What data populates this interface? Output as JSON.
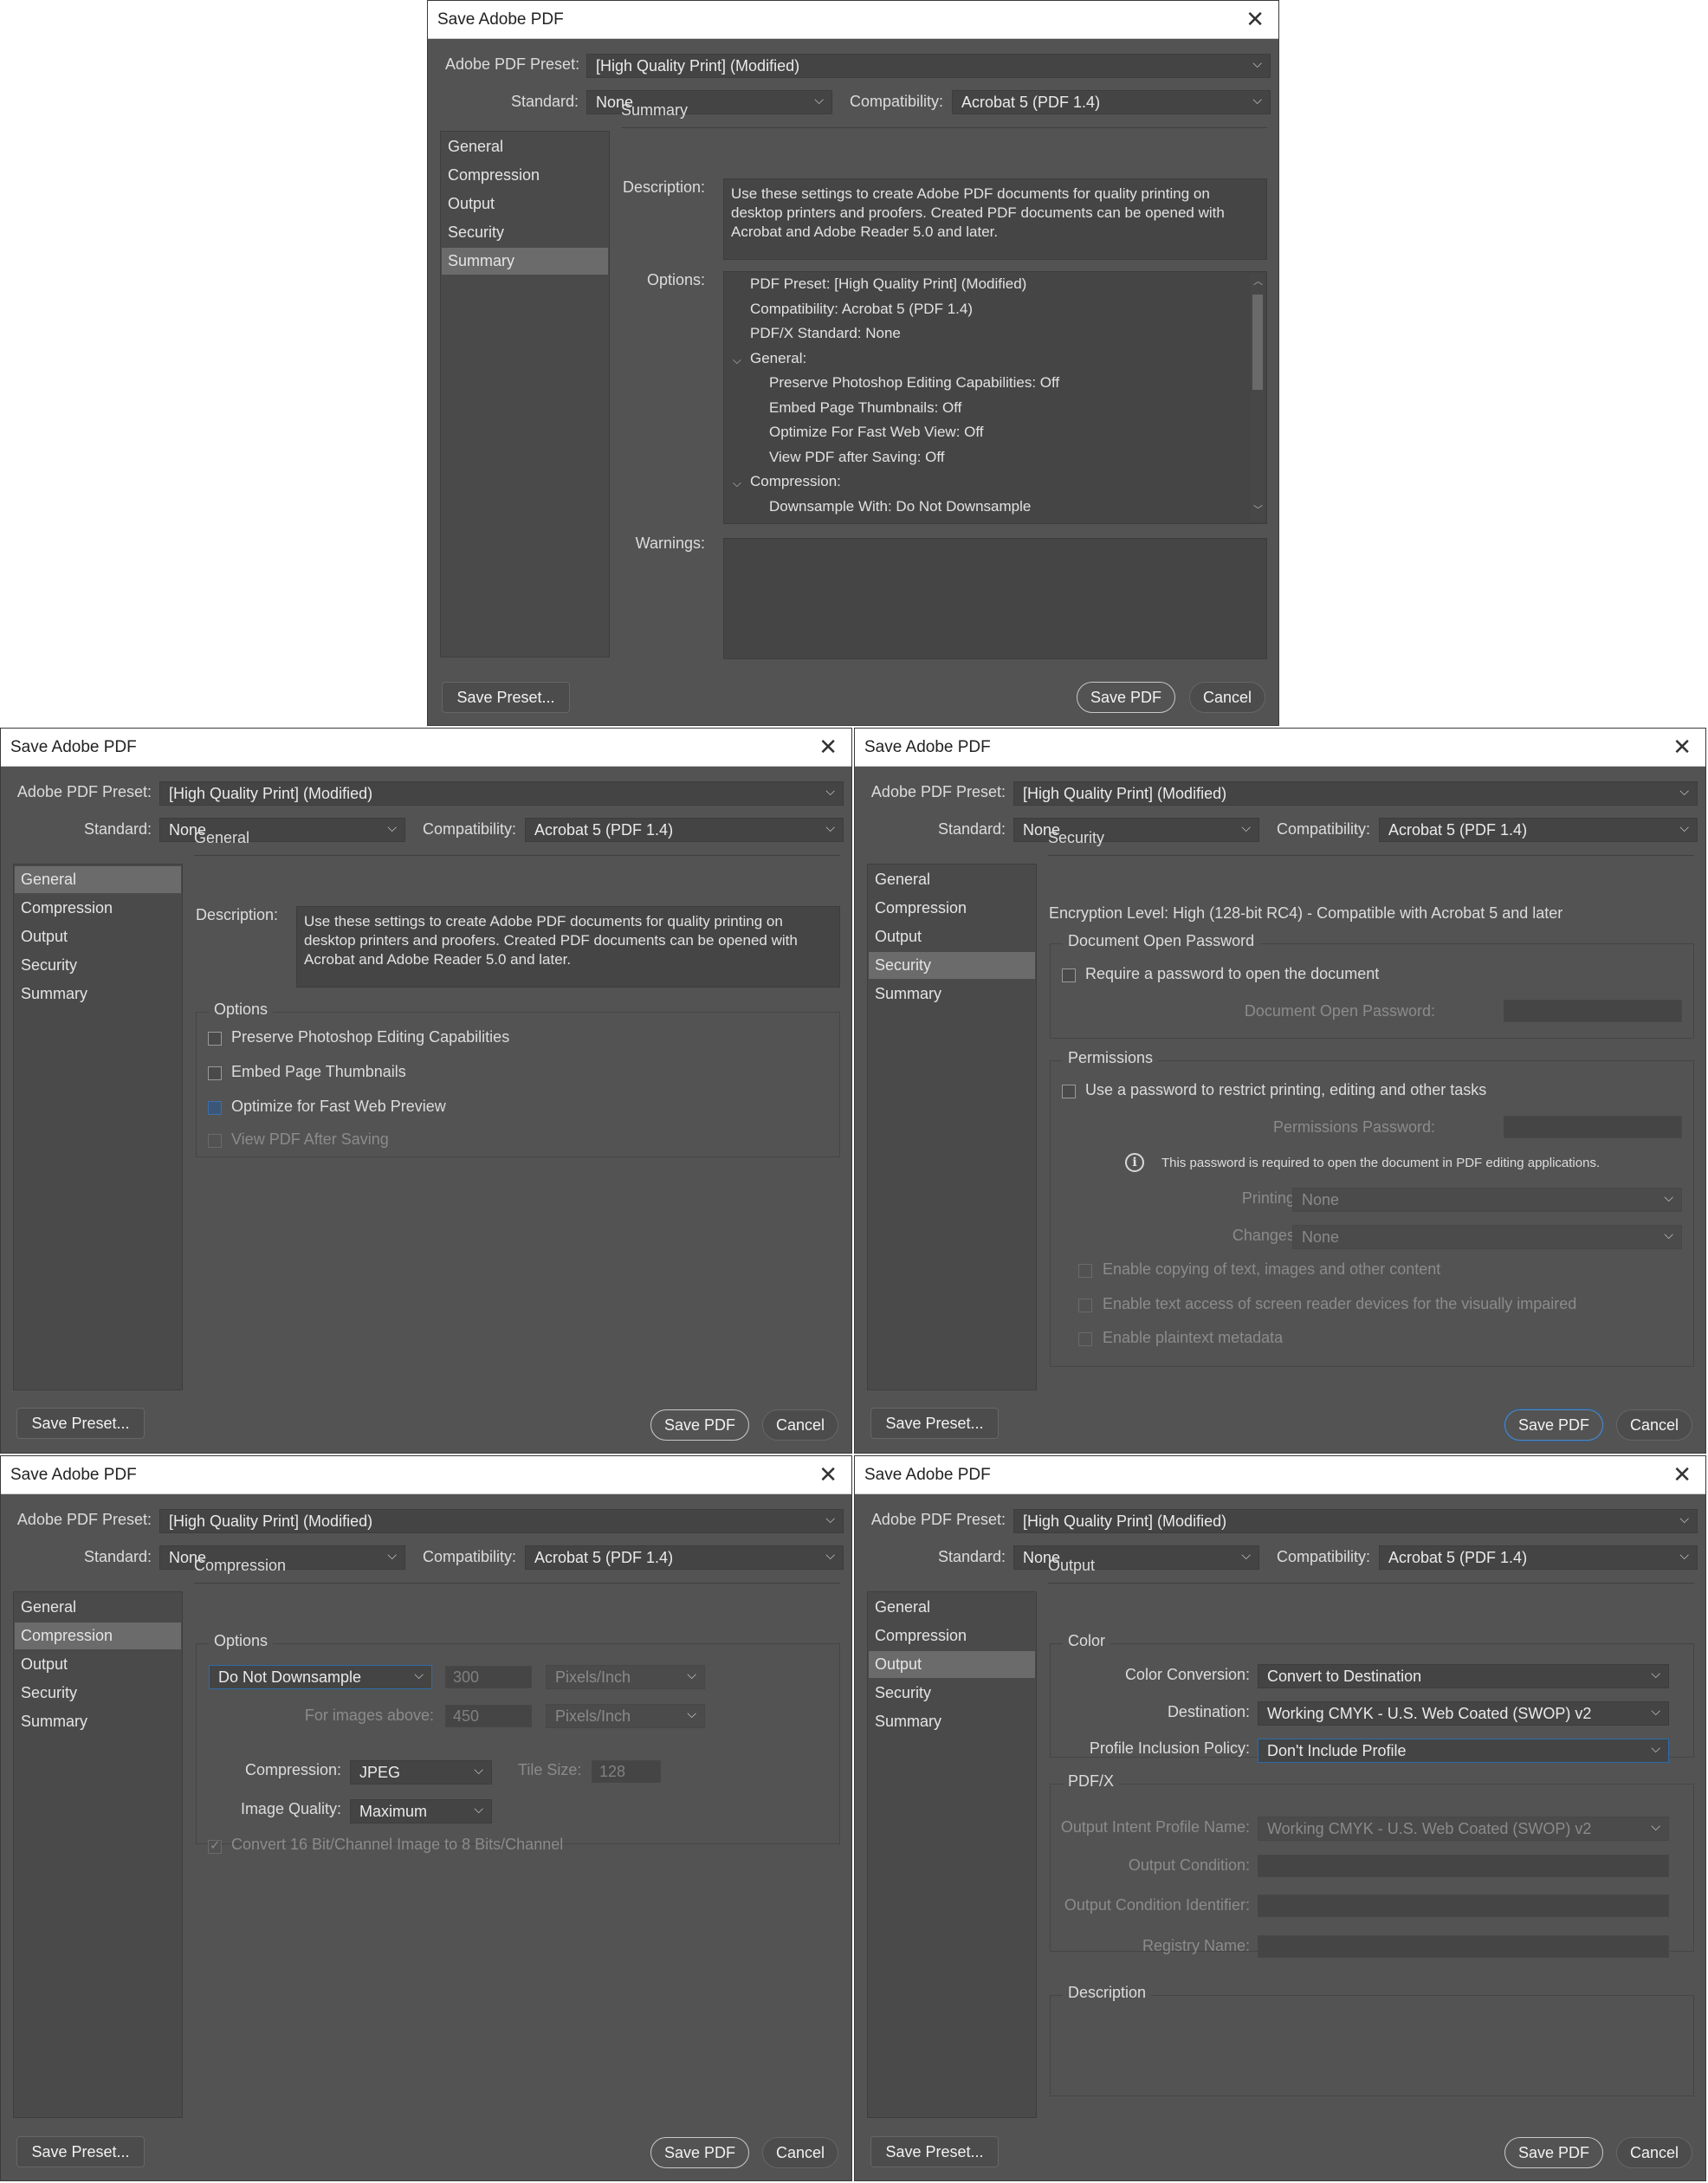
{
  "common": {
    "title": "Save Adobe PDF",
    "preset_label": "Adobe PDF Preset:",
    "preset_value": "[High Quality Print] (Modified)",
    "standard_label": "Standard:",
    "standard_value": "None",
    "compat_label": "Compatibility:",
    "compat_value": "Acrobat 5 (PDF 1.4)",
    "nav": [
      "General",
      "Compression",
      "Output",
      "Security",
      "Summary"
    ],
    "save_preset": "Save Preset...",
    "save_pdf": "Save PDF",
    "cancel": "Cancel",
    "description_label": "Description:",
    "description_text": "Use these settings to create Adobe PDF documents for quality printing on desktop printers and proofers.  Created PDF documents can be opened with Acrobat and Adobe Reader 5.0 and later."
  },
  "summary": {
    "heading": "Summary",
    "options_label": "Options:",
    "warnings_label": "Warnings:",
    "options_lines": [
      "PDF Preset: [High Quality Print] (Modified)",
      "Compatibility: Acrobat 5 (PDF 1.4)",
      "PDF/X Standard: None",
      "General:",
      "Preserve Photoshop Editing Capabilities: Off",
      "Embed Page Thumbnails: Off",
      "Optimize For Fast Web View: Off",
      "View PDF after Saving: Off",
      "Compression:",
      "Downsample With: Do Not Downsample"
    ]
  },
  "general": {
    "heading": "General",
    "options_title": "Options",
    "checkboxes": [
      "Preserve Photoshop Editing Capabilities",
      "Embed Page Thumbnails",
      "Optimize for Fast Web Preview",
      "View PDF After Saving"
    ]
  },
  "security": {
    "heading": "Security",
    "encryption": "Encryption Level: High (128-bit RC4) - Compatible with Acrobat 5 and later",
    "open_group": "Document Open Password",
    "require_open": "Require a password to open the document",
    "open_pw_label": "Document Open Password:",
    "perm_group": "Permissions",
    "use_perm": "Use a password to restrict printing, editing and other tasks",
    "perm_pw_label": "Permissions Password:",
    "info": "This password is required to open the document in PDF editing applications.",
    "printing_label": "Printing Allowed:",
    "printing_value": "None",
    "changes_label": "Changes Allowed:",
    "changes_value": "None",
    "enable_copy": "Enable copying of text, images and other content",
    "enable_screen": "Enable text access of screen reader devices for the visually impaired",
    "enable_meta": "Enable plaintext metadata"
  },
  "compression": {
    "heading": "Compression",
    "options_title": "Options",
    "downsample_value": "Do Not Downsample",
    "ppi_value": "300",
    "ppi_unit": "Pixels/Inch",
    "above_label": "For images above:",
    "above_value": "450",
    "above_unit": "Pixels/Inch",
    "compression_label": "Compression:",
    "compression_value": "JPEG",
    "tile_label": "Tile Size:",
    "tile_value": "128",
    "quality_label": "Image Quality:",
    "quality_value": "Maximum",
    "convert_16": "Convert 16 Bit/Channel Image to 8 Bits/Channel"
  },
  "output": {
    "heading": "Output",
    "color_group": "Color",
    "conv_label": "Color Conversion:",
    "conv_value": "Convert to Destination",
    "dest_label": "Destination:",
    "dest_value": "Working CMYK - U.S. Web Coated (SWOP) v2",
    "policy_label": "Profile Inclusion Policy:",
    "policy_value": "Don't Include Profile",
    "pdfx_group": "PDF/X",
    "intent_label": "Output Intent Profile Name:",
    "intent_value": "Working CMYK - U.S. Web Coated (SWOP) v2",
    "cond_label": "Output Condition:",
    "cond_id_label": "Output Condition Identifier:",
    "registry_label": "Registry Name:",
    "desc_group": "Description"
  }
}
